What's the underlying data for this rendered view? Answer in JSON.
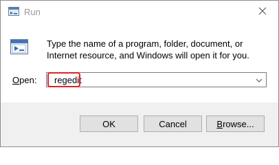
{
  "window": {
    "title": "Run",
    "description": "Type the name of a program, folder, document, or Internet resource, and Windows will open it for you."
  },
  "open_field": {
    "label_mnemonic": "O",
    "label_rest": "pen:",
    "value": "regedit"
  },
  "buttons": {
    "ok": "OK",
    "cancel": "Cancel",
    "browse_mnemonic": "B",
    "browse_rest": "rowse..."
  },
  "icons": {
    "title": "run-dialog-icon",
    "app": "run-dialog-icon",
    "close": "close-icon",
    "dropdown": "chevron-down-icon"
  },
  "colors": {
    "highlight": "#e0202a",
    "footer": "#f0f0f0"
  }
}
